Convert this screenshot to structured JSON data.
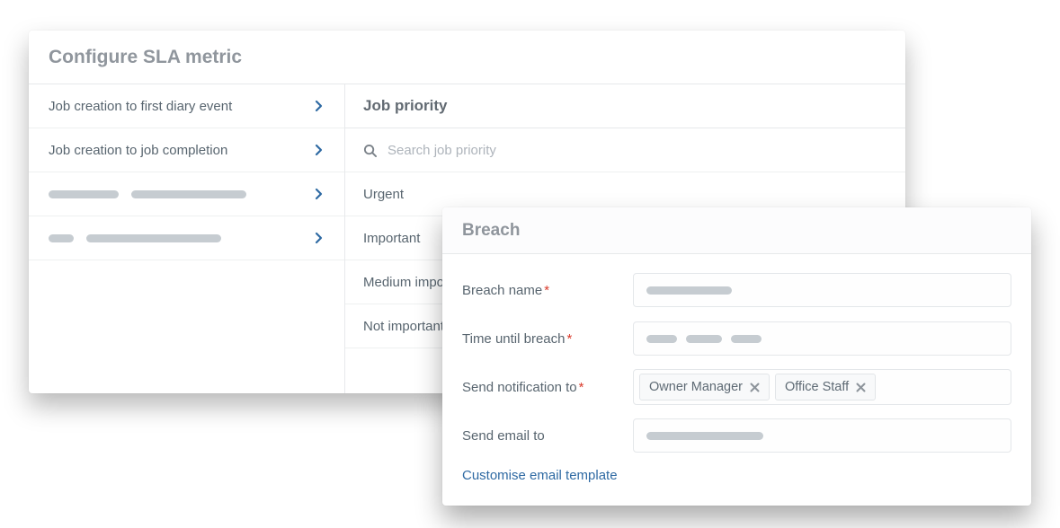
{
  "panelA": {
    "title": "Configure SLA metric",
    "leftItems": [
      "Job creation to first diary event",
      "Job creation to job completion"
    ],
    "rightHeader": "Job priority",
    "searchPlaceholder": "Search job priority",
    "priorities": [
      "Urgent",
      "Important",
      "Medium importance",
      "Not important"
    ]
  },
  "panelB": {
    "title": "Breach",
    "labels": {
      "breachName": "Breach name",
      "timeUntil": "Time until breach",
      "sendNotif": "Send notification to",
      "sendEmail": "Send email to"
    },
    "tags": [
      "Owner Manager",
      "Office Staff"
    ],
    "link": "Customise email template"
  },
  "colors": {
    "accent": "#2f6aa3",
    "required": "#d93a2b"
  }
}
